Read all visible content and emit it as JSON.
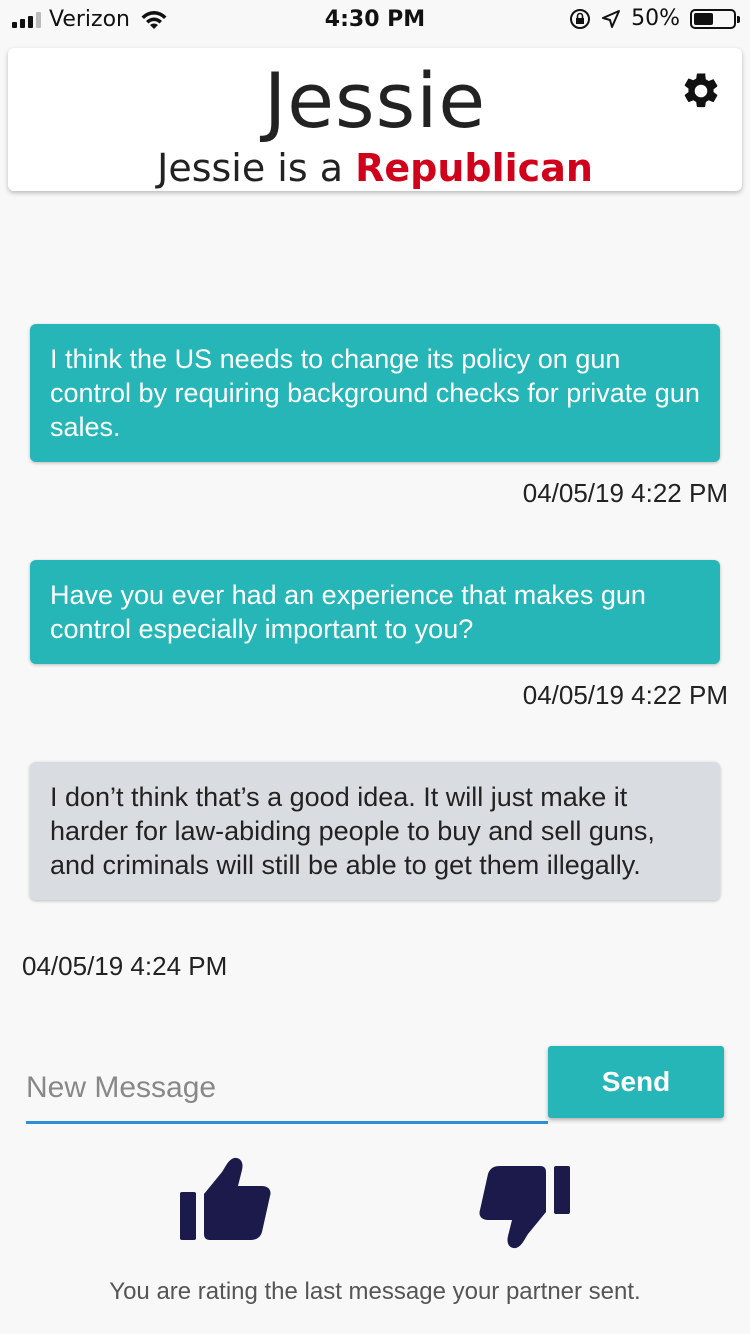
{
  "status_bar": {
    "carrier": "Verizon",
    "time": "4:30 PM",
    "battery_text": "50%",
    "battery_level": 0.5
  },
  "header": {
    "name": "Jessie",
    "subtitle_prefix": "Jessie is a",
    "party": "Republican",
    "party_color": "#d0021b",
    "settings_icon": "gear-icon"
  },
  "messages": [
    {
      "direction": "outgoing",
      "text": "I think the US needs to change its policy on gun control by requiring background checks for private gun sales.",
      "timestamp": "04/05/19 4:22 PM"
    },
    {
      "direction": "outgoing",
      "text": "Have you ever had an experience that makes gun control especially important to you?",
      "timestamp": "04/05/19 4:22 PM"
    },
    {
      "direction": "incoming",
      "text": "I don’t think that’s a good idea. It will just make it harder for law-abiding people to buy and sell guns, and criminals will still be able to get them illegally.",
      "timestamp": "04/05/19 4:24 PM"
    }
  ],
  "composer": {
    "placeholder": "New Message",
    "send_label": "Send"
  },
  "rating": {
    "thumbs_up_icon": "thumbs-up-icon",
    "thumbs_down_icon": "thumbs-down-icon",
    "note": "You are rating the last message your partner sent."
  },
  "colors": {
    "accent": "#26b6b7",
    "icon_dark": "#1c1a4a",
    "input_underline": "#2e8fd6",
    "incoming_bubble": "#d9dde2"
  }
}
